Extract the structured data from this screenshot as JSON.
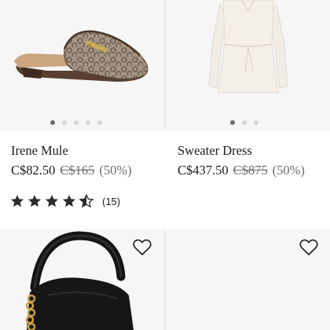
{
  "products": [
    {
      "name": "Irene Mule",
      "price": "C$82.50",
      "original_price": "C$165",
      "discount": "(50%)",
      "image_dots": {
        "count": 5,
        "active": 1
      },
      "rating": {
        "stars": 4.5,
        "count": "(15)"
      }
    },
    {
      "name": "Sweater Dress",
      "price": "C$437.50",
      "original_price": "C$875",
      "discount": "(50%)",
      "image_dots": {
        "count": 3,
        "active": 1
      }
    },
    {
      "wishlist_icon": "heart-outline-icon"
    },
    {
      "wishlist_icon": "heart-outline-icon"
    }
  ],
  "colors": {
    "tile_background": "#f6f6f6",
    "divider": "#eeeeee",
    "text": "#1b1b1b",
    "muted_text": "#6d6d6d",
    "star": "#2b2b2b"
  }
}
